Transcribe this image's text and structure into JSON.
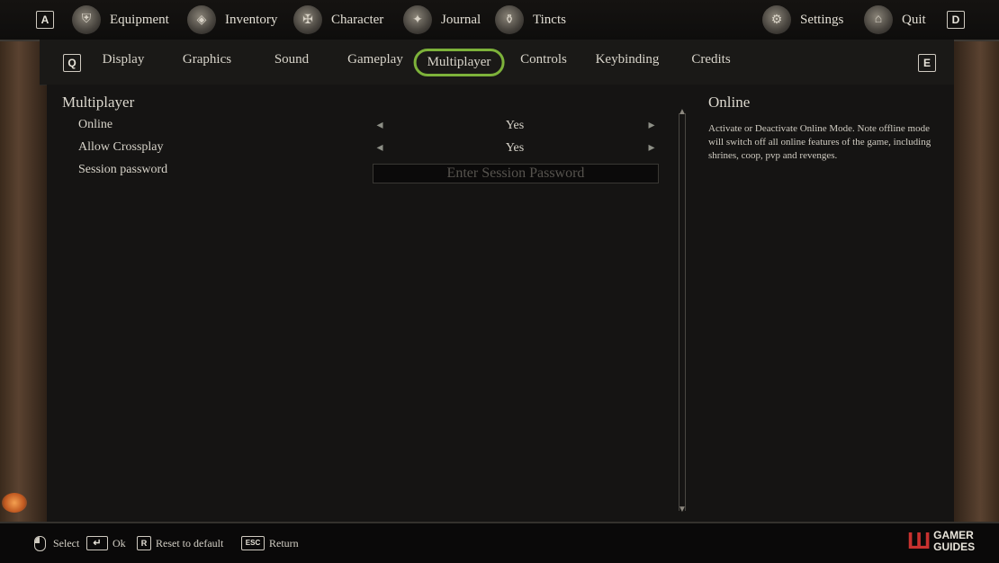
{
  "topnav": {
    "left_key": "A",
    "right_key": "D",
    "items": [
      {
        "label": "Equipment",
        "icon": "helmet-icon"
      },
      {
        "label": "Inventory",
        "icon": "bag-icon"
      },
      {
        "label": "Character",
        "icon": "character-icon"
      },
      {
        "label": "Journal",
        "icon": "journal-icon"
      },
      {
        "label": "Tincts",
        "icon": "tincts-icon"
      },
      {
        "label": "Settings",
        "icon": "settings-icon"
      },
      {
        "label": "Quit",
        "icon": "gate-icon"
      }
    ]
  },
  "subnav": {
    "left_key": "Q",
    "right_key": "E",
    "tabs": [
      "Display",
      "Graphics",
      "Sound",
      "Gameplay",
      "Multiplayer",
      "Controls",
      "Keybinding",
      "Credits"
    ],
    "active": "Multiplayer",
    "active_color": "#7db23a"
  },
  "section": {
    "title": "Multiplayer",
    "rows": [
      {
        "label": "Online",
        "value": "Yes"
      },
      {
        "label": "Allow Crossplay",
        "value": "Yes"
      },
      {
        "label": "Session password",
        "placeholder": "Enter Session Password"
      }
    ]
  },
  "info": {
    "title": "Online",
    "text": "Activate or Deactivate Online Mode. Note offline mode will switch off all online features of the game, including shrines, coop, pvp and revenges."
  },
  "footer": {
    "hints": [
      {
        "key": "",
        "label": "Select"
      },
      {
        "key": "↵",
        "label": "Ok"
      },
      {
        "key": "R",
        "label": "Reset to default"
      },
      {
        "key": "ESC",
        "label": "Return"
      }
    ],
    "logo_line1": "GAMER",
    "logo_line2": "GUIDES",
    "logo_mark": "Ш"
  }
}
